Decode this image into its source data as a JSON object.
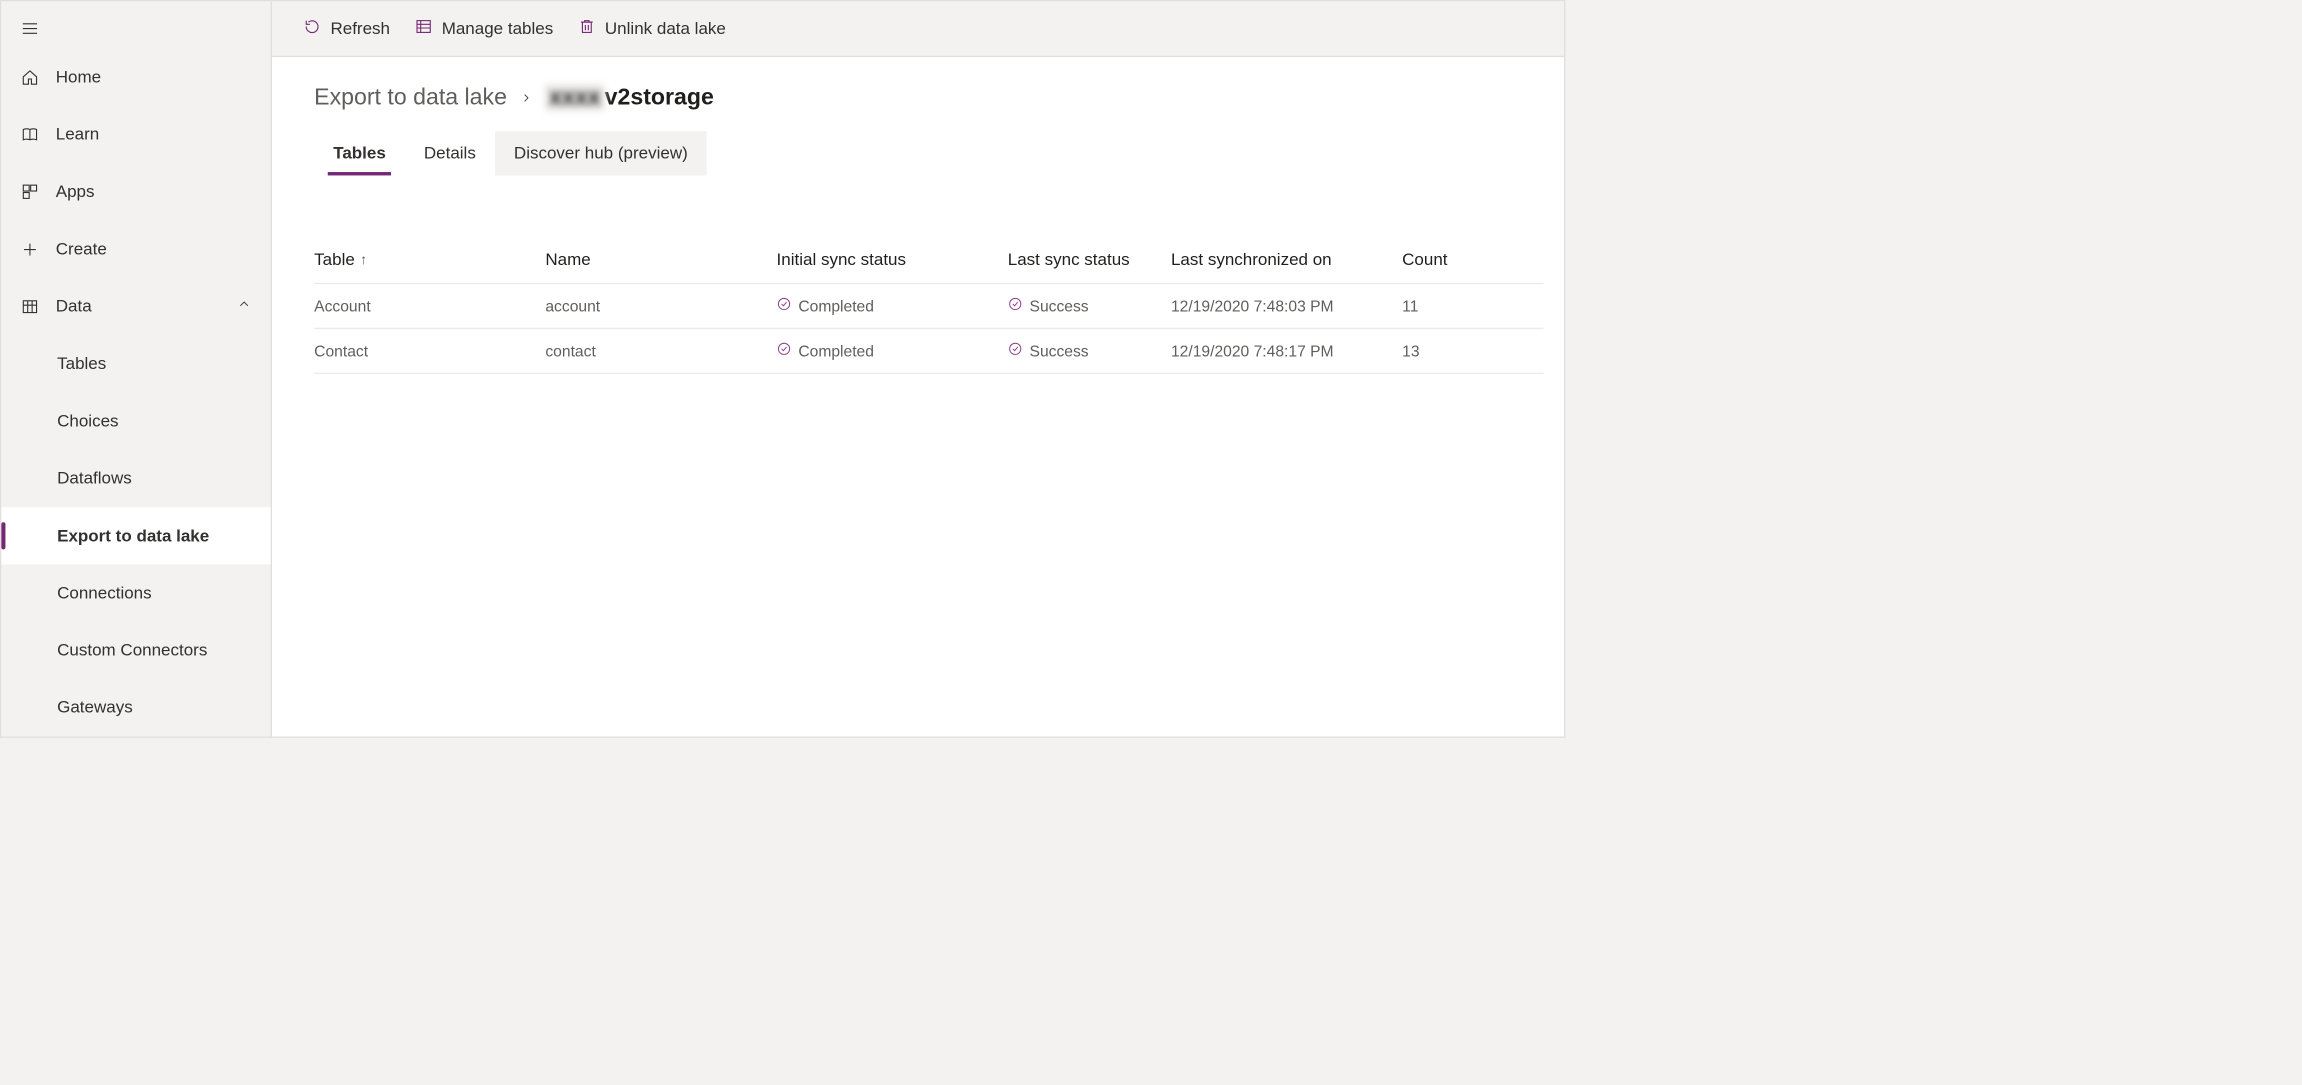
{
  "sidebar": {
    "items": [
      {
        "icon": "home",
        "label": "Home"
      },
      {
        "icon": "book",
        "label": "Learn"
      },
      {
        "icon": "grid",
        "label": "Apps"
      },
      {
        "icon": "plus",
        "label": "Create"
      },
      {
        "icon": "table",
        "label": "Data",
        "expanded": true
      }
    ],
    "sub_items": [
      {
        "label": "Tables"
      },
      {
        "label": "Choices"
      },
      {
        "label": "Dataflows"
      },
      {
        "label": "Export to data lake",
        "active": true
      },
      {
        "label": "Connections"
      },
      {
        "label": "Custom Connectors"
      },
      {
        "label": "Gateways"
      }
    ]
  },
  "command_bar": {
    "refresh": "Refresh",
    "manage_tables": "Manage tables",
    "unlink": "Unlink data lake"
  },
  "breadcrumb": {
    "parent": "Export to data lake",
    "current_prefix_blurred": "xxxx",
    "current_suffix": "v2storage"
  },
  "tabs": [
    {
      "label": "Tables",
      "active": true
    },
    {
      "label": "Details"
    },
    {
      "label": "Discover hub (preview)",
      "highlight": true
    }
  ],
  "table": {
    "headers": {
      "table": "Table",
      "name": "Name",
      "initial_sync": "Initial sync status",
      "last_sync": "Last sync status",
      "last_synchronized_on": "Last synchronized on",
      "count": "Count"
    },
    "rows": [
      {
        "table": "Account",
        "name": "account",
        "initial_sync": "Completed",
        "last_sync": "Success",
        "last_synchronized_on": "12/19/2020 7:48:03 PM",
        "count": "11"
      },
      {
        "table": "Contact",
        "name": "contact",
        "initial_sync": "Completed",
        "last_sync": "Success",
        "last_synchronized_on": "12/19/2020 7:48:17 PM",
        "count": "13"
      }
    ]
  },
  "colors": {
    "accent": "#742774",
    "status_icon": "#8a3a8a"
  }
}
